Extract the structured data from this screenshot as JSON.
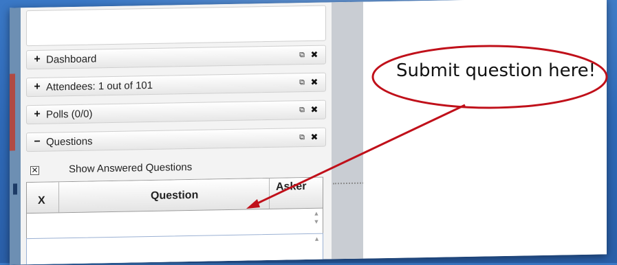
{
  "panels": [
    {
      "toggle": "+",
      "title": "Dashboard"
    },
    {
      "toggle": "+",
      "title": "Attendees:  1 out of 101"
    },
    {
      "toggle": "+",
      "title": "Polls (0/0)"
    },
    {
      "toggle": "−",
      "title": "Questions"
    }
  ],
  "panel_icons": {
    "popout": "popout-icon",
    "close": "close-icon"
  },
  "questions": {
    "show_answered_label": "Show Answered Questions",
    "show_answered_checked": true,
    "columns": {
      "x": "X",
      "question": "Question",
      "asker": "Asker"
    }
  },
  "callout": {
    "text": "Submit question here!",
    "color": "#c0101a"
  },
  "colors": {
    "background": "#3a78c6",
    "annotation": "#c0101a"
  }
}
